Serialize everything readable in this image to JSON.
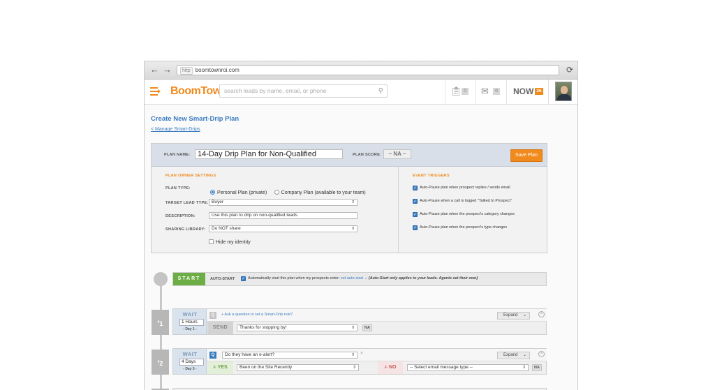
{
  "browser": {
    "protocol": "http",
    "url": "boomtownroi.com",
    "back_glyph": "←",
    "forward_glyph": "→",
    "reload_glyph": "⟳"
  },
  "header": {
    "logo": "BoomTown!",
    "search_placeholder": "search leads by name, email, or phone",
    "tasks_count": "0",
    "messages_count": "0",
    "now_label": "NOW",
    "now_count": "26"
  },
  "page": {
    "title": "Create New Smart-Drip Plan",
    "back_link": "< Manage Smart-Drips"
  },
  "plan": {
    "name_label": "PLAN NAME:",
    "name_value": "14-Day Drip Plan for Non-Qualified",
    "score_label": "PLAN SCORE:",
    "score_value": "~ NA ~",
    "save_label": "Save Plan"
  },
  "owner_settings": {
    "section_title": "PLAN OWNER SETTINGS",
    "plan_type_label": "PLAN TYPE:",
    "plan_type_options": [
      "Personal Plan (private)",
      "Company Plan (available to your team)"
    ],
    "plan_type_selected": 0,
    "target_lead_label": "TARGET LEAD TYPE:",
    "target_lead_value": "Buyer",
    "description_label": "DESCRIPTION:",
    "description_value": "Use this plan to drip on non-qualified leads",
    "sharing_label": "SHARING LIBRARY:",
    "sharing_value": "Do NOT share",
    "hide_identity_label": "Hide my identity",
    "hide_identity_checked": false
  },
  "event_triggers": {
    "section_title": "EVENT TRIGGERS",
    "items": [
      {
        "label": "Auto-Pause plan when prospect replies / sends email",
        "checked": true
      },
      {
        "label": "Auto-Pause when a call is logged \"Talked to Prospect\"",
        "checked": true
      },
      {
        "label": "Auto-Pause plan when the prospect's category changes",
        "checked": true
      },
      {
        "label": "Auto-Pause plan when the prospect's type changes",
        "checked": true
      }
    ]
  },
  "start": {
    "label": "START",
    "autostart_label": "AUTO-START",
    "autostart_text": "Automatically start this plan when my prospects enter:",
    "autostart_link": "set auto-start ⌄",
    "autostart_note": "(Auto-Start only applies to your leads. Agents set their own)"
  },
  "steps": [
    {
      "number": "1",
      "wait_label": "WAIT",
      "wait_value": "1 Hours",
      "day_label": "- Day 1 -",
      "question": "+ Ask a question to set a Smart-Drip rule?",
      "expand_label": "Expand",
      "send_label": "SEND",
      "send_value": "Thanks for stopping by!",
      "na_label": "NA"
    },
    {
      "number": "2",
      "wait_label": "WAIT",
      "wait_value": "4 Days",
      "day_label": "- Day 5 -",
      "question_value": "Do they have an e-alert?",
      "expand_label": "Expand",
      "if_label": "IF",
      "yes_label": "YES",
      "yes_value": "Been on the Site Recently",
      "no_label": "NO",
      "no_value": "-- Select email message type --",
      "na_label": "NA"
    }
  ]
}
